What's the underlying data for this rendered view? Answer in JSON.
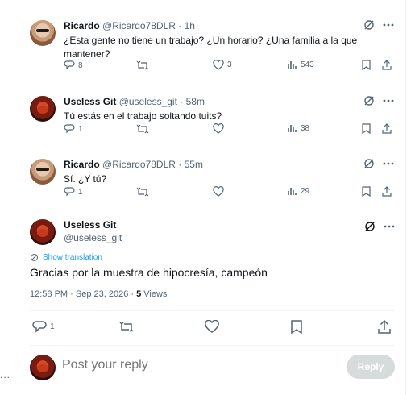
{
  "edge_menu": "...",
  "replies": [
    {
      "name": "Ricardo",
      "handle": "@Ricardo78DLR",
      "time": "1h",
      "text": "¿Esta gente no tiene un trabajo? ¿Un horario? ¿Una familia a la que mantener?",
      "replies_count": "8",
      "reposts_count": "",
      "likes_count": "3",
      "views_count": "543"
    },
    {
      "name": "Useless Git",
      "handle": "@useless_git",
      "time": "58m",
      "text": "Tú estás en el trabajo soltando tuits?",
      "replies_count": "1",
      "reposts_count": "",
      "likes_count": "",
      "views_count": "38"
    },
    {
      "name": "Ricardo",
      "handle": "@Ricardo78DLR",
      "time": "55m",
      "text": "Sí. ¿Y tú?",
      "replies_count": "1",
      "reposts_count": "",
      "likes_count": "",
      "views_count": "29"
    }
  ],
  "main_tweet": {
    "name": "Useless Git",
    "handle": "@useless_git",
    "translate_label": "Show translation",
    "text": "Gracias por la muestra de hipocresía, campeón",
    "datetime": "12:58 PM · Sep 23, 2026 ·",
    "views_count": "5",
    "views_label": "Views",
    "replies_count": "1"
  },
  "composer": {
    "placeholder": "Post your reply",
    "button_label": "Reply"
  },
  "colors": {
    "text": "#0f1419",
    "muted": "#536471",
    "link": "#1d9bf0",
    "border": "#eff3f4",
    "button_disabled": "#d7dbdc"
  }
}
